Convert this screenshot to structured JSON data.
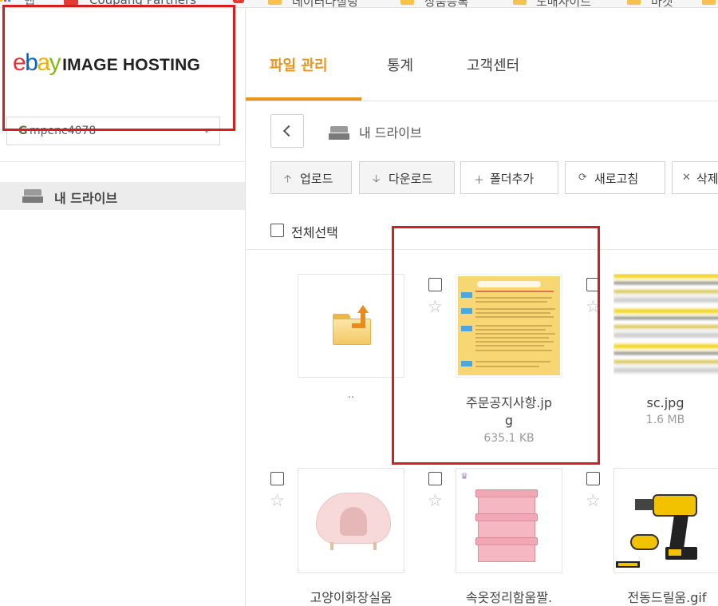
{
  "bookmarks": {
    "apps_label": "앱",
    "coupang_label": "Coupang Partners",
    "folders": [
      "데이터다칠링",
      "상품등록",
      "도매사이트",
      "마켓"
    ]
  },
  "sidebar": {
    "logo": {
      "ebay": "ebay",
      "suffix": "IMAGE HOSTING"
    },
    "account": {
      "prefix": "G",
      "name": "mpenc4078"
    },
    "drive_label": "내 드라이브"
  },
  "nav": {
    "tabs": [
      {
        "label": "파일 관리",
        "active": true
      },
      {
        "label": "통계",
        "active": false
      },
      {
        "label": "고객센터",
        "active": false
      }
    ]
  },
  "path": {
    "current": "내 드라이브"
  },
  "toolbar": {
    "upload": "업로드",
    "download": "다운로드",
    "new_folder": "폴더추가",
    "refresh": "새로고침",
    "delete": "삭제"
  },
  "select_all": "전체선택",
  "files": [
    {
      "name": "..",
      "size": ""
    },
    {
      "name": "주문공지사항.jp\ng",
      "size": "635.1 KB"
    },
    {
      "name": "sc.jpg",
      "size": "1.6 MB"
    },
    {
      "name": "고양이화장실움",
      "size": ""
    },
    {
      "name": "속옷정리함움짤.",
      "size": ""
    },
    {
      "name": "전동드릴움.gif",
      "size": ""
    }
  ],
  "colors": {
    "accent": "#e6951f",
    "annotation_red": "#d21f1f"
  },
  "icons": {
    "apps": "apps-grid-icon",
    "drive": "hard-drive-icon",
    "back": "chevron-left-icon",
    "upload": "arrow-up-icon",
    "download": "arrow-down-icon",
    "new_folder": "plus-icon",
    "refresh": "refresh-icon",
    "delete": "close-icon",
    "favorite": "star-icon"
  }
}
